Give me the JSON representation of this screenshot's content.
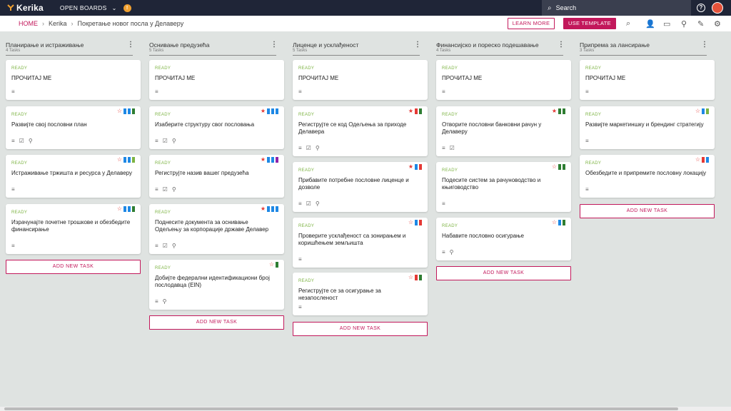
{
  "app": {
    "logo": "Kerika",
    "open_boards": "OPEN BOARDS",
    "search_placeholder": "Search"
  },
  "breadcrumb": {
    "home": "HOME",
    "org": "Kerika",
    "board": "Покретање новог посла у Делаверу"
  },
  "toolbar": {
    "learn_more": "LEARN MORE",
    "use_template": "USE TEMPLATE"
  },
  "colors": {
    "accent": "#c2185b",
    "ready": "#7cb342",
    "topbar": "#1f2537"
  },
  "columns": [
    {
      "title": "Планирање и истраживање",
      "count": "4 Tasks",
      "add": "ADD NEW TASK",
      "cards": [
        {
          "status": "READY",
          "title": "ПРОЧИТАЈ МЕ"
        },
        {
          "status": "READY",
          "title": "Развијте свој пословни план"
        },
        {
          "status": "READY",
          "title": "Истраживање тржишта и ресурса у Делаверу"
        },
        {
          "status": "READY",
          "title": "Израчунајте почетне трошкове и обезбедите финансирање"
        }
      ]
    },
    {
      "title": "Оснивање предузећа",
      "count": "5 Tasks",
      "add": "ADD NEW TASK",
      "cards": [
        {
          "status": "READY",
          "title": "ПРОЧИТАЈ МЕ"
        },
        {
          "status": "READY",
          "title": "Изаберите структуру свог пословања"
        },
        {
          "status": "READY",
          "title": "Региструјте назив вашег предузећа"
        },
        {
          "status": "READY",
          "title": "Поднесите документа за оснивање Одељењу за корпорације државе Делавер"
        },
        {
          "status": "READY",
          "title": "Добијте федерални идентификациони број послодавца (EIN)"
        }
      ]
    },
    {
      "title": "Лиценце и усклађеност",
      "count": "5 Tasks",
      "add": "ADD NEW TASK",
      "cards": [
        {
          "status": "READY",
          "title": "ПРОЧИТАЈ МЕ"
        },
        {
          "status": "READY",
          "title": "Региструјте се код Одељења за приходе Делавера"
        },
        {
          "status": "READY",
          "title": "Прибавите потребне пословне лиценце и дозволе"
        },
        {
          "status": "READY",
          "title": "Проверите усклађеност са зонирањем и коришћењем земљишта"
        },
        {
          "status": "READY",
          "title": "Региструјте се за осигурање за незапосленост"
        }
      ]
    },
    {
      "title": "Финансијско и пореско подешавање",
      "count": "4 Tasks",
      "add": "ADD NEW TASK",
      "cards": [
        {
          "status": "READY",
          "title": "ПРОЧИТАЈ МЕ"
        },
        {
          "status": "READY",
          "title": "Отворите пословни банковни рачун у Делаверу"
        },
        {
          "status": "READY",
          "title": "Подесите систем за рачуноводство и књиговодство"
        },
        {
          "status": "READY",
          "title": "Набавите пословно осигурање"
        }
      ]
    },
    {
      "title": "Припрема за лансирање",
      "count": "3 Tasks",
      "add": "ADD NEW TASK",
      "cards": [
        {
          "status": "READY",
          "title": "ПРОЧИТАЈ МЕ"
        },
        {
          "status": "READY",
          "title": "Развијте маркетиншку и брендинг стратегију"
        },
        {
          "status": "READY",
          "title": "Обезбедите и припремите пословну локацију"
        }
      ]
    }
  ]
}
